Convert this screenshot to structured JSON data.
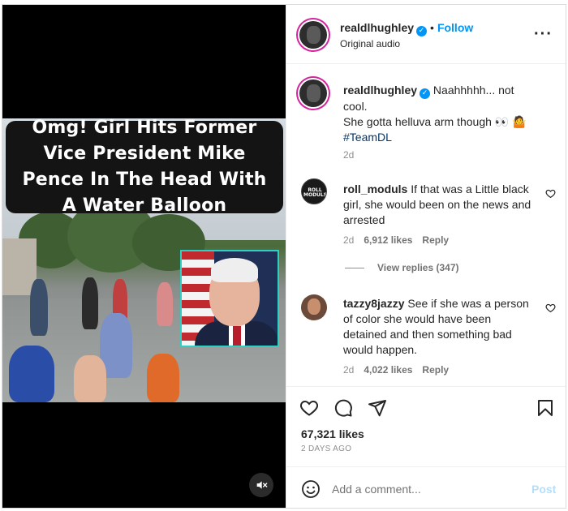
{
  "video": {
    "headline": "Omg! Girl Hits Former Vice President Mike Pence In The Head With A Water Balloon",
    "mute_icon": "speaker-muted-icon"
  },
  "header": {
    "username": "realdlhughley",
    "follow_label": "Follow",
    "subtitle": "Original audio",
    "more_icon": "more-horizontal-icon"
  },
  "caption": {
    "username": "realdlhughley",
    "line1": "Naahhhhh... not cool.",
    "line2": "She gotta helluva arm though 👀 🤷",
    "hashtag": "#TeamDL",
    "time": "2d"
  },
  "comments": [
    {
      "username": "roll_moduls",
      "text": "If that was a Little black girl, she would been on the news and arrested",
      "time": "2d",
      "likes": "6,912 likes",
      "reply_label": "Reply",
      "avatar_text": "ROLL MODULS"
    },
    {
      "username": "tazzy8jazzy",
      "text": "See if she was a person of color she would have been detained and then something bad would happen.",
      "time": "2d",
      "likes": "4,022 likes",
      "reply_label": "Reply"
    }
  ],
  "view_replies": "View replies (347)",
  "actions": {
    "likes": "67,321 likes",
    "date": "2 DAYS AGO"
  },
  "composer": {
    "placeholder": "Add a comment...",
    "post_label": "Post"
  },
  "colors": {
    "accent": "#0095f6",
    "post_disabled": "#b2dffc",
    "inset_border": "#2fd0c4"
  }
}
